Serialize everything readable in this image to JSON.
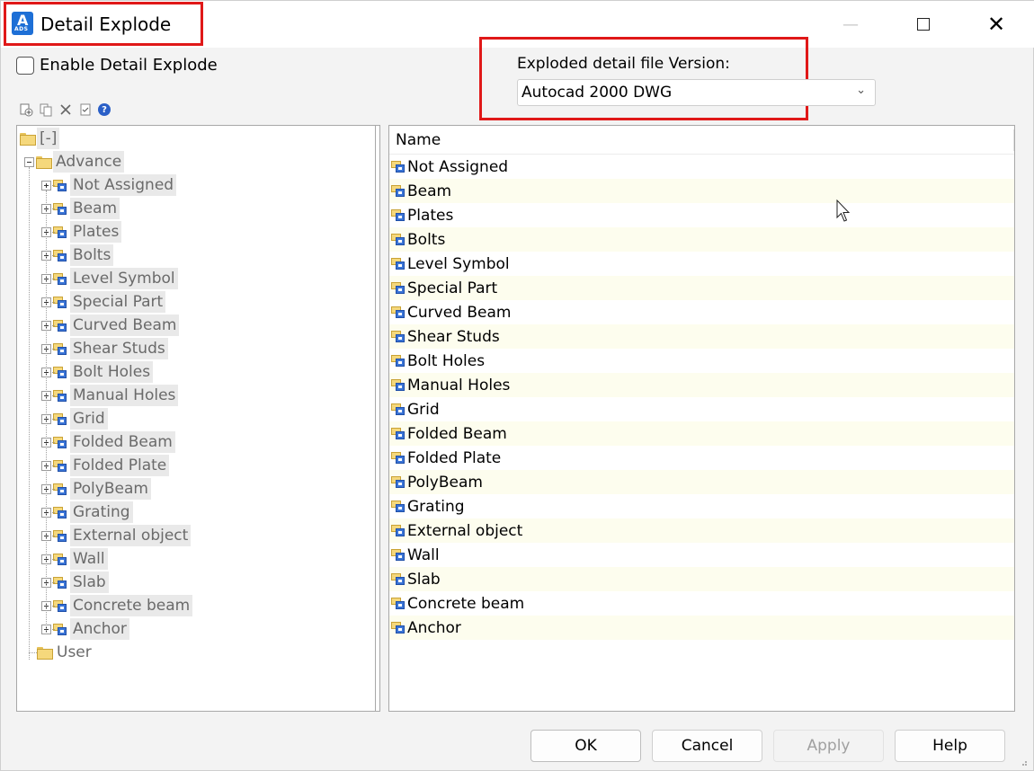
{
  "window": {
    "title": "Detail Explode",
    "app_icon_letter": "A",
    "app_icon_sub": "ADS",
    "accent_color": "#1d6fd6"
  },
  "options": {
    "enable_label": "Enable Detail Explode",
    "enable_checked": false,
    "version_label": "Exploded detail file Version:",
    "version_value": "Autocad 2000 DWG"
  },
  "toolbar": {
    "icons": [
      "new-icon",
      "copy-icon",
      "delete-icon",
      "check-icon",
      "help-icon"
    ]
  },
  "tree": {
    "root_label": "[-]",
    "advance_label": "Advance",
    "user_label": "User",
    "items": [
      "Not Assigned",
      "Beam",
      "Plates",
      "Bolts",
      "Level Symbol",
      "Special Part",
      "Curved Beam",
      "Shear Studs",
      "Bolt Holes",
      "Manual Holes",
      "Grid",
      "Folded Beam",
      "Folded Plate",
      "PolyBeam",
      "Grating",
      "External object",
      "Wall",
      "Slab",
      "Concrete beam",
      "Anchor"
    ]
  },
  "list": {
    "column_name": "Name",
    "items": [
      "Not Assigned",
      "Beam",
      "Plates",
      "Bolts",
      "Level Symbol",
      "Special Part",
      "Curved Beam",
      "Shear Studs",
      "Bolt Holes",
      "Manual Holes",
      "Grid",
      "Folded Beam",
      "Folded Plate",
      "PolyBeam",
      "Grating",
      "External object",
      "Wall",
      "Slab",
      "Concrete beam",
      "Anchor"
    ]
  },
  "buttons": {
    "ok": "OK",
    "cancel": "Cancel",
    "apply": "Apply",
    "help": "Help"
  }
}
